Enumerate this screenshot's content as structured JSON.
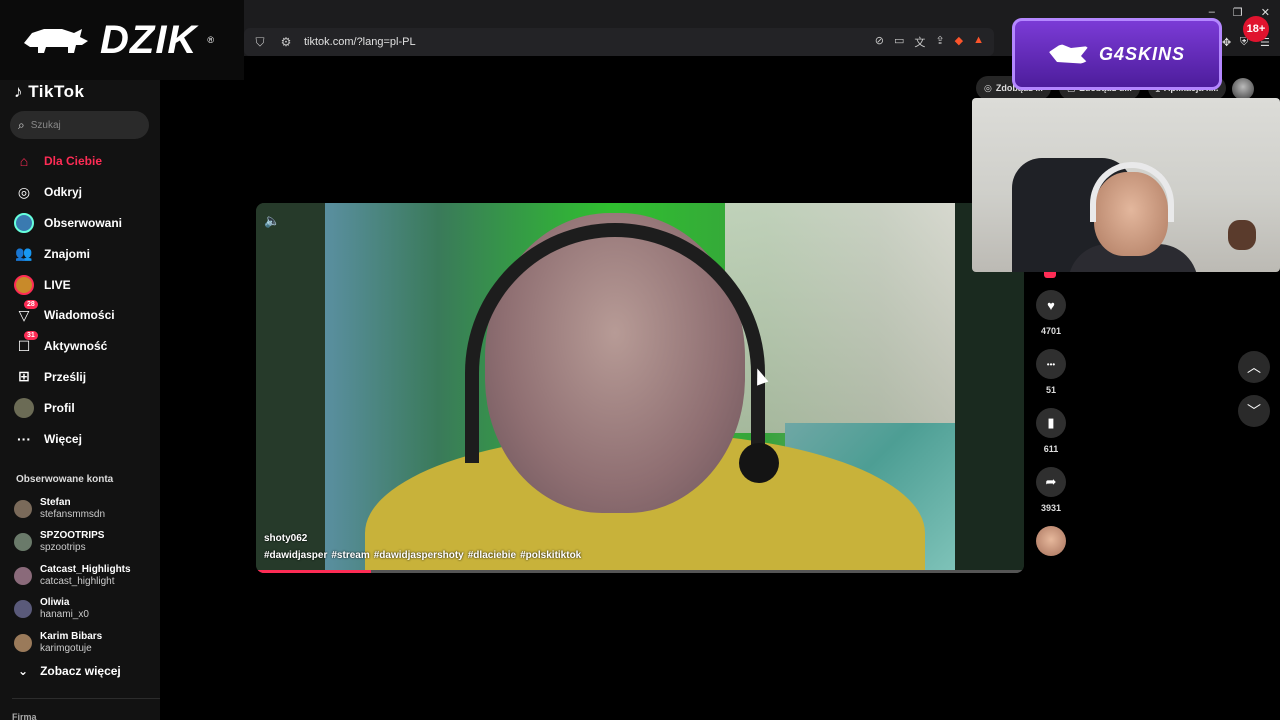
{
  "browser": {
    "url": "tiktok.com/?lang=pl-PL",
    "window_controls": [
      "–",
      "❐",
      "✕"
    ]
  },
  "overlay": {
    "streamer_logo": "DZIK",
    "streamer_logo_mark": "®",
    "sponsor_logo": "G4SKINS",
    "age_badge": "18+"
  },
  "sidebar": {
    "logo": "TikTok",
    "search_placeholder": "Szukaj",
    "nav": [
      {
        "label": "Dla Ciebie",
        "icon": "home-icon",
        "active": true
      },
      {
        "label": "Odkryj",
        "icon": "compass-icon"
      },
      {
        "label": "Obserwowani",
        "icon": "following-avatar-icon"
      },
      {
        "label": "Znajomi",
        "icon": "friends-icon"
      },
      {
        "label": "LIVE",
        "icon": "live-icon"
      },
      {
        "label": "Wiadomości",
        "icon": "messages-icon",
        "badge": "28"
      },
      {
        "label": "Aktywność",
        "icon": "activity-icon",
        "badge": "31"
      },
      {
        "label": "Prześlij",
        "icon": "upload-icon"
      },
      {
        "label": "Profil",
        "icon": "profile-avatar-icon"
      },
      {
        "label": "Więcej",
        "icon": "more-icon"
      }
    ],
    "followed_title": "Obserwowane konta",
    "followed": [
      {
        "name": "Stefan",
        "handle": "stefansmmsdn",
        "color": "#7a6a5a"
      },
      {
        "name": "SPZOOTRIPS",
        "handle": "spzootrips",
        "color": "#6a7a6a"
      },
      {
        "name": "Catcast_Highlights",
        "handle": "catcast_highlight",
        "color": "#8a6a7a"
      },
      {
        "name": "Oliwia",
        "handle": "hanami_x0",
        "color": "#5a5a7a"
      },
      {
        "name": "Karim Bibars",
        "handle": "karimgotuje",
        "color": "#9a7a5a"
      }
    ],
    "see_more": "Zobacz więcej",
    "footer_section": "Firma"
  },
  "top_pills": [
    "Zdobądź ...",
    "Zdobądź d...",
    "Aplikacja k..."
  ],
  "video": {
    "username": "shoty062",
    "hashtags": [
      "#dawidjasper",
      "#stream",
      "#dawidjaspershoty",
      "#dlaciebie",
      "#polskitiktok"
    ],
    "progress": 0.15
  },
  "actions": [
    {
      "icon": "heart-icon",
      "glyph": "♥",
      "count": "4701"
    },
    {
      "icon": "comment-icon",
      "glyph": "•••",
      "count": "51"
    },
    {
      "icon": "bookmark-icon",
      "glyph": "▮",
      "count": "611"
    },
    {
      "icon": "share-icon",
      "glyph": "➦",
      "count": "3931"
    }
  ],
  "colors": {
    "accent": "#fe2c55",
    "sponsor_purple": "#6a2dc4"
  }
}
